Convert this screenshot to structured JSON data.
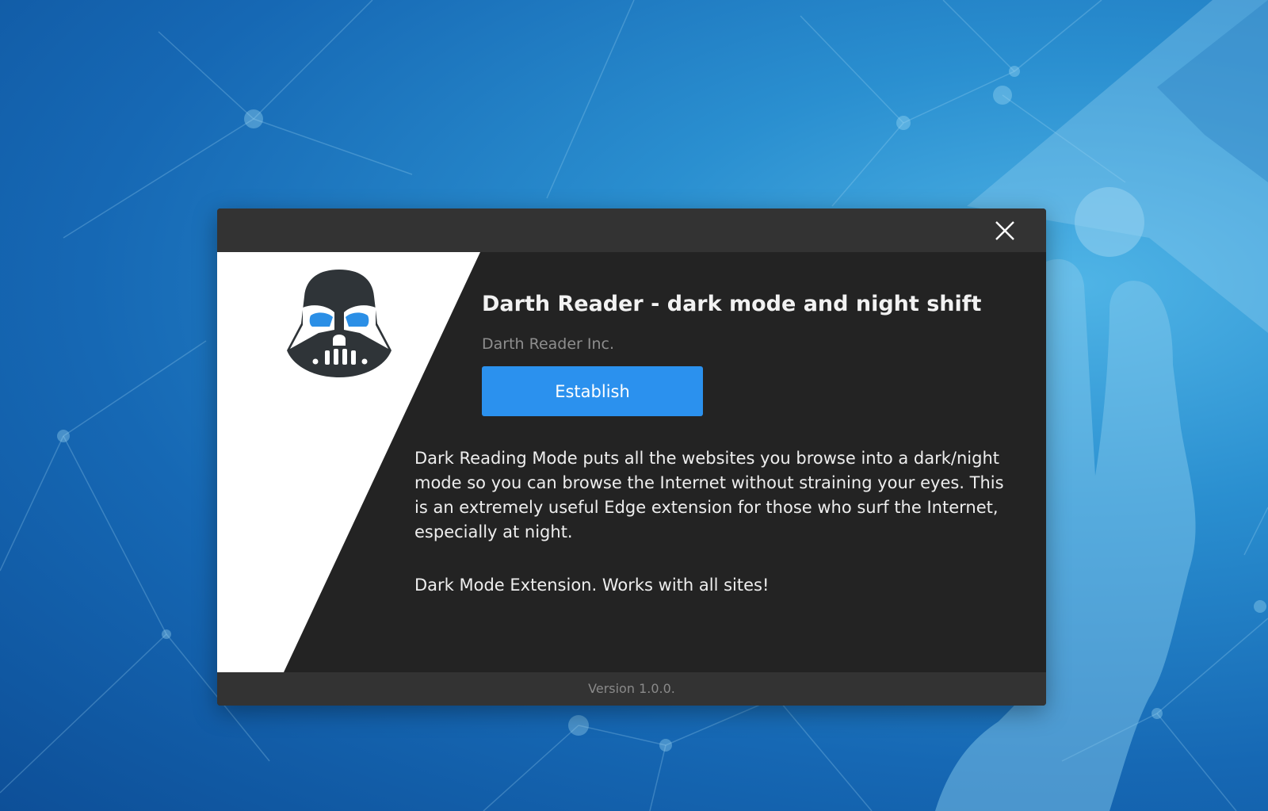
{
  "dialog": {
    "close_icon": "close-icon",
    "extension_icon": "darth-helmet-icon",
    "title": "Darth Reader - dark mode and night shift",
    "publisher": "Darth Reader Inc.",
    "install_button_label": "Establish",
    "description": "Dark Reading Mode puts all the websites you browse into a dark/night mode so you can browse the Internet without straining your eyes. This is an extremely useful Edge extension for those who surf the Internet, especially at night.",
    "tagline": "Dark Mode Extension. Works with all sites!",
    "version": "Version 1.0.0."
  },
  "colors": {
    "accent": "#2b91ee",
    "dialog_background": "#232323",
    "titlebar_background": "#333333",
    "helmet_eyes": "#2b8fe6"
  }
}
